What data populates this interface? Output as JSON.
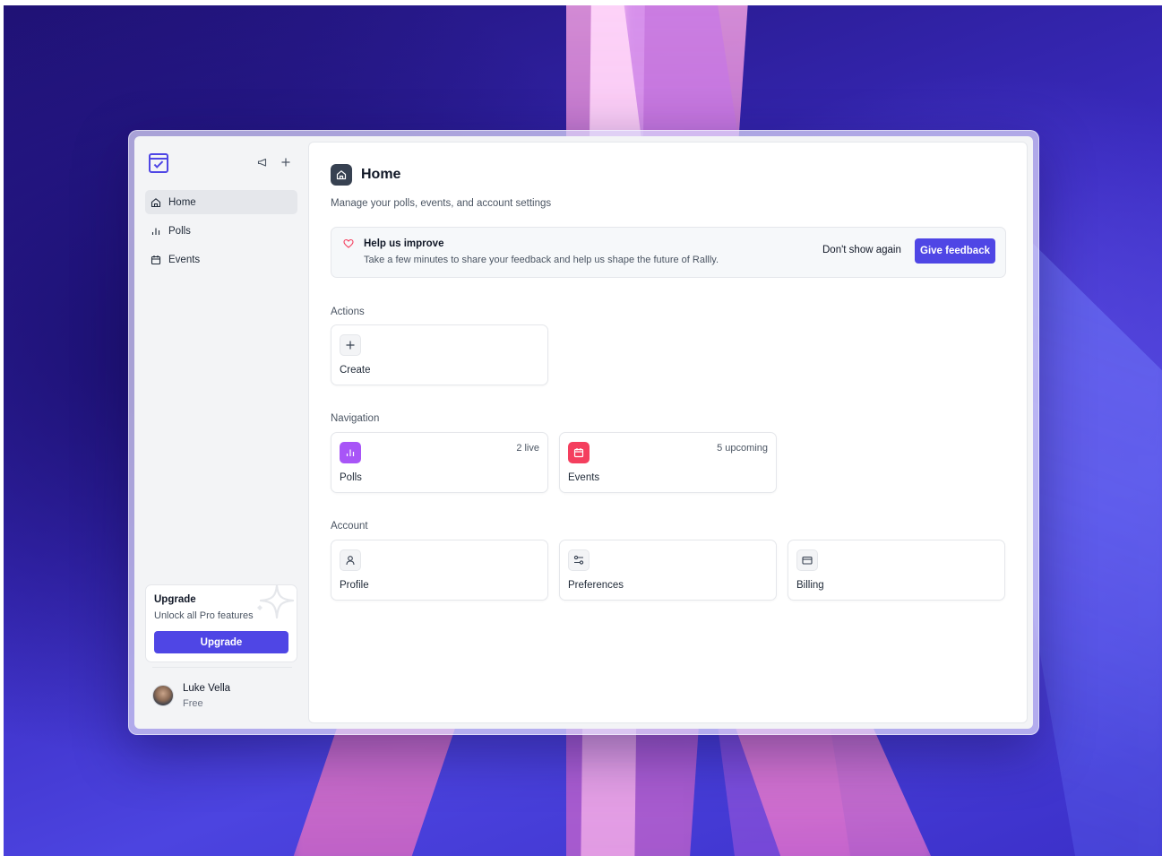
{
  "sidebar": {
    "items": [
      {
        "label": "Home",
        "icon": "home-icon",
        "active": true
      },
      {
        "label": "Polls",
        "icon": "bar-chart-icon",
        "active": false
      },
      {
        "label": "Events",
        "icon": "calendar-icon",
        "active": false
      }
    ],
    "upgrade": {
      "title": "Upgrade",
      "subtitle": "Unlock all Pro features",
      "button": "Upgrade"
    },
    "user": {
      "name": "Luke Vella",
      "plan": "Free"
    }
  },
  "main": {
    "title": "Home",
    "subtitle": "Manage your polls, events, and account settings",
    "feedback": {
      "title": "Help us improve",
      "description": "Take a few minutes to share your feedback and help us shape the future of Rallly.",
      "dismiss": "Don't show again",
      "action": "Give feedback"
    },
    "sections": {
      "actions": {
        "label": "Actions",
        "cards": [
          {
            "label": "Create",
            "icon": "plus-icon"
          }
        ]
      },
      "navigation": {
        "label": "Navigation",
        "cards": [
          {
            "label": "Polls",
            "meta": "2 live",
            "icon": "bar-chart-icon",
            "color": "#a855f7"
          },
          {
            "label": "Events",
            "meta": "5 upcoming",
            "icon": "calendar-icon",
            "color": "#f43f5e"
          }
        ]
      },
      "account": {
        "label": "Account",
        "cards": [
          {
            "label": "Profile",
            "icon": "user-icon"
          },
          {
            "label": "Preferences",
            "icon": "sliders-icon"
          },
          {
            "label": "Billing",
            "icon": "credit-card-icon"
          }
        ]
      }
    }
  },
  "colors": {
    "accent": "#4f46e5",
    "polls": "#a855f7",
    "events": "#f43f5e"
  }
}
